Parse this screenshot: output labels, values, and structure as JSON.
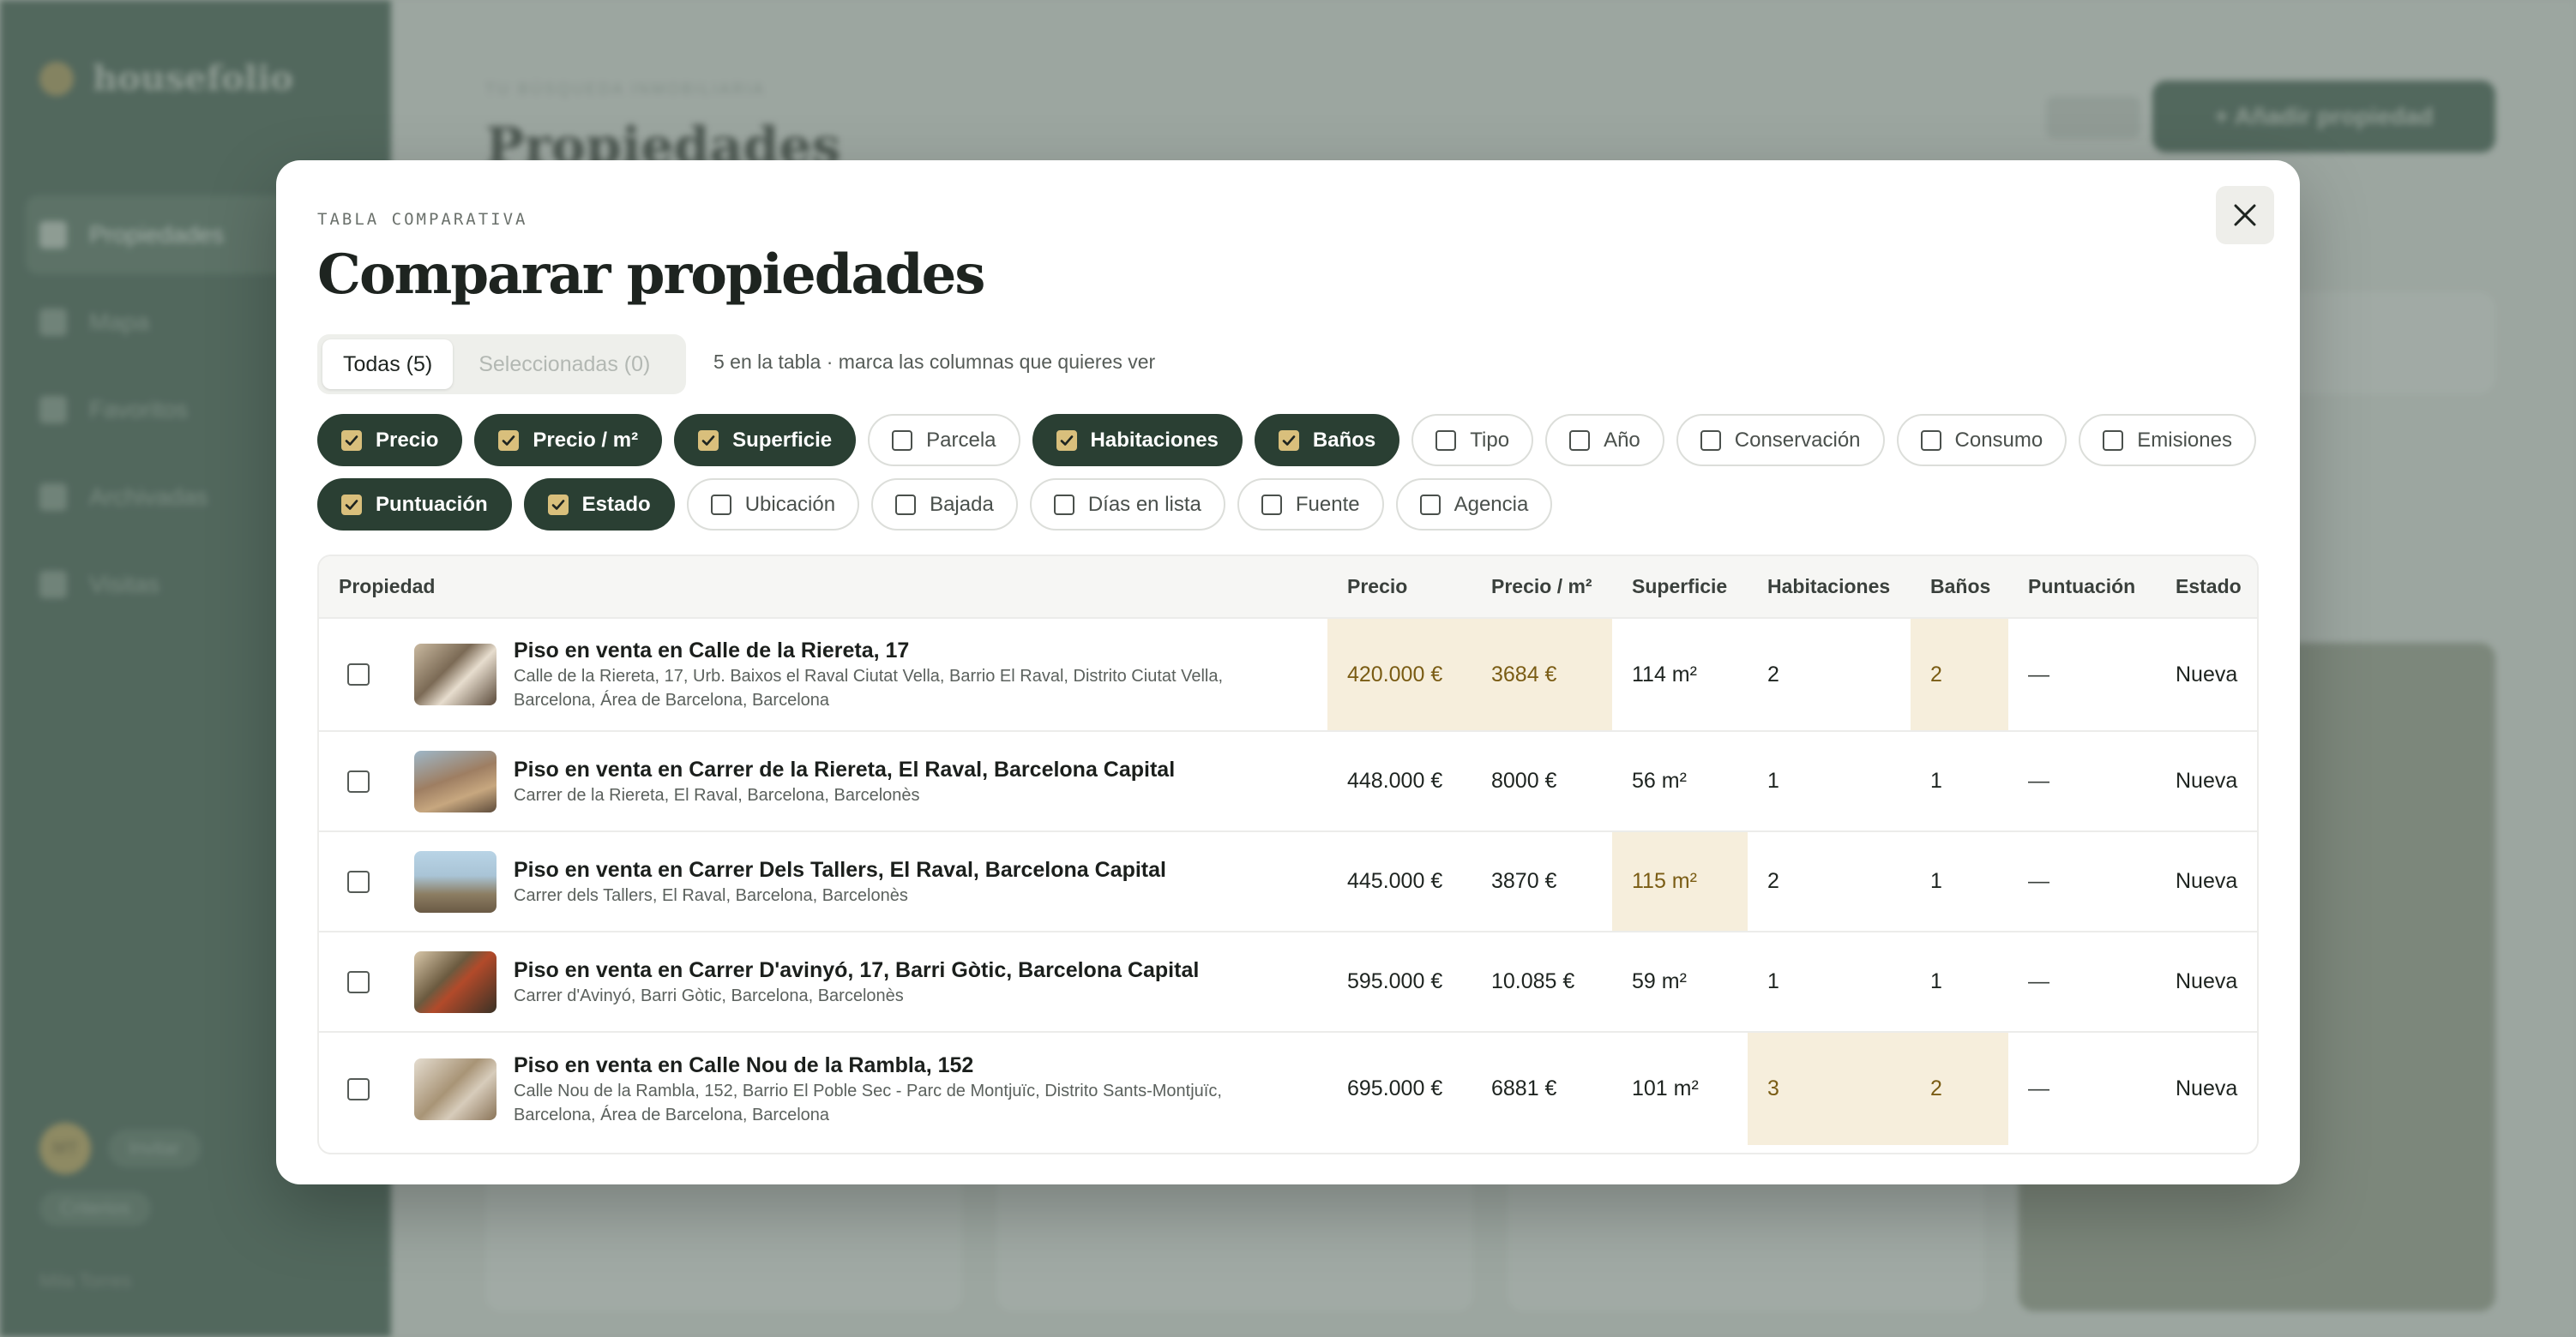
{
  "background": {
    "logo_text": "housefolio",
    "nav": [
      "Propiedades",
      "Mapa",
      "Favoritos",
      "Archivadas",
      "Visitas"
    ],
    "user_initials": "MT",
    "user_pill": "Invitar",
    "user_pill2": "Criterios",
    "footer": "Mila Torres",
    "kicker": "TU BÚSQUEDA INMOBILIARIA",
    "title": "Propiedades",
    "add_button": "+ Añadir propiedad"
  },
  "modal": {
    "kicker": "TABLA COMPARATIVA",
    "title": "Comparar propiedades",
    "tabs": [
      {
        "label": "Todas (5)",
        "active": true
      },
      {
        "label": "Seleccionadas (0)",
        "active": false
      }
    ],
    "hint": "5 en la tabla · marca las columnas que quieres ver",
    "chips_row1": [
      {
        "label": "Precio",
        "checked": true
      },
      {
        "label": "Precio / m²",
        "checked": true
      },
      {
        "label": "Superficie",
        "checked": true
      },
      {
        "label": "Parcela",
        "checked": false
      },
      {
        "label": "Habitaciones",
        "checked": true
      },
      {
        "label": "Baños",
        "checked": true
      },
      {
        "label": "Tipo",
        "checked": false
      },
      {
        "label": "Año",
        "checked": false
      },
      {
        "label": "Conservación",
        "checked": false
      },
      {
        "label": "Consumo",
        "checked": false
      },
      {
        "label": "Emisiones",
        "checked": false
      }
    ],
    "chips_row2": [
      {
        "label": "Puntuación",
        "checked": true
      },
      {
        "label": "Estado",
        "checked": true
      },
      {
        "label": "Ubicación",
        "checked": false
      },
      {
        "label": "Bajada",
        "checked": false
      },
      {
        "label": "Días en lista",
        "checked": false
      },
      {
        "label": "Fuente",
        "checked": false
      },
      {
        "label": "Agencia",
        "checked": false
      }
    ],
    "table": {
      "headers": [
        "Propiedad",
        "Precio",
        "Precio / m²",
        "Superficie",
        "Habitaciones",
        "Baños",
        "Puntuación",
        "Estado"
      ],
      "rows": [
        {
          "name": "Piso en venta en Calle de la Riereta, 17",
          "address": "Calle de la Riereta, 17, Urb. Baixos el Raval Ciutat Vella, Barrio El Raval, Distrito Ciutat Vella, Barcelona, Área de Barcelona, Barcelona",
          "precio": "420.000 €",
          "precio_m2": "3684 €",
          "superficie": "114 m²",
          "habitaciones": "2",
          "banos": "2",
          "puntuacion": "—",
          "estado": "Nueva"
        },
        {
          "name": "Piso en venta en Carrer de la Riereta, El Raval, Barcelona Capital",
          "address": "Carrer de la Riereta, El Raval, Barcelona, Barcelonès",
          "precio": "448.000 €",
          "precio_m2": "8000 €",
          "superficie": "56 m²",
          "habitaciones": "1",
          "banos": "1",
          "puntuacion": "—",
          "estado": "Nueva"
        },
        {
          "name": "Piso en venta en Carrer Dels Tallers, El Raval, Barcelona Capital",
          "address": "Carrer dels Tallers, El Raval, Barcelona, Barcelonès",
          "precio": "445.000 €",
          "precio_m2": "3870 €",
          "superficie": "115 m²",
          "habitaciones": "2",
          "banos": "1",
          "puntuacion": "—",
          "estado": "Nueva"
        },
        {
          "name": "Piso en venta en Carrer D'avinyó, 17, Barri Gòtic, Barcelona Capital",
          "address": "Carrer d'Avinyó, Barri Gòtic, Barcelona, Barcelonès",
          "precio": "595.000 €",
          "precio_m2": "10.085 €",
          "superficie": "59 m²",
          "habitaciones": "1",
          "banos": "1",
          "puntuacion": "—",
          "estado": "Nueva"
        },
        {
          "name": "Piso en venta en Calle Nou de la Rambla, 152",
          "address": "Calle Nou de la Rambla, 152, Barrio El Poble Sec - Parc de Montjuïc, Distrito Sants-Montjuïc, Barcelona, Área de Barcelona, Barcelona",
          "precio": "695.000 €",
          "precio_m2": "6881 €",
          "superficie": "101 m²",
          "habitaciones": "3",
          "banos": "2",
          "puntuacion": "—",
          "estado": "Nueva"
        }
      ]
    }
  },
  "colors": {
    "accent_dark": "#2a3f33",
    "checkbox_gold": "#d9bf7c",
    "highlight": "#f6eedc"
  }
}
